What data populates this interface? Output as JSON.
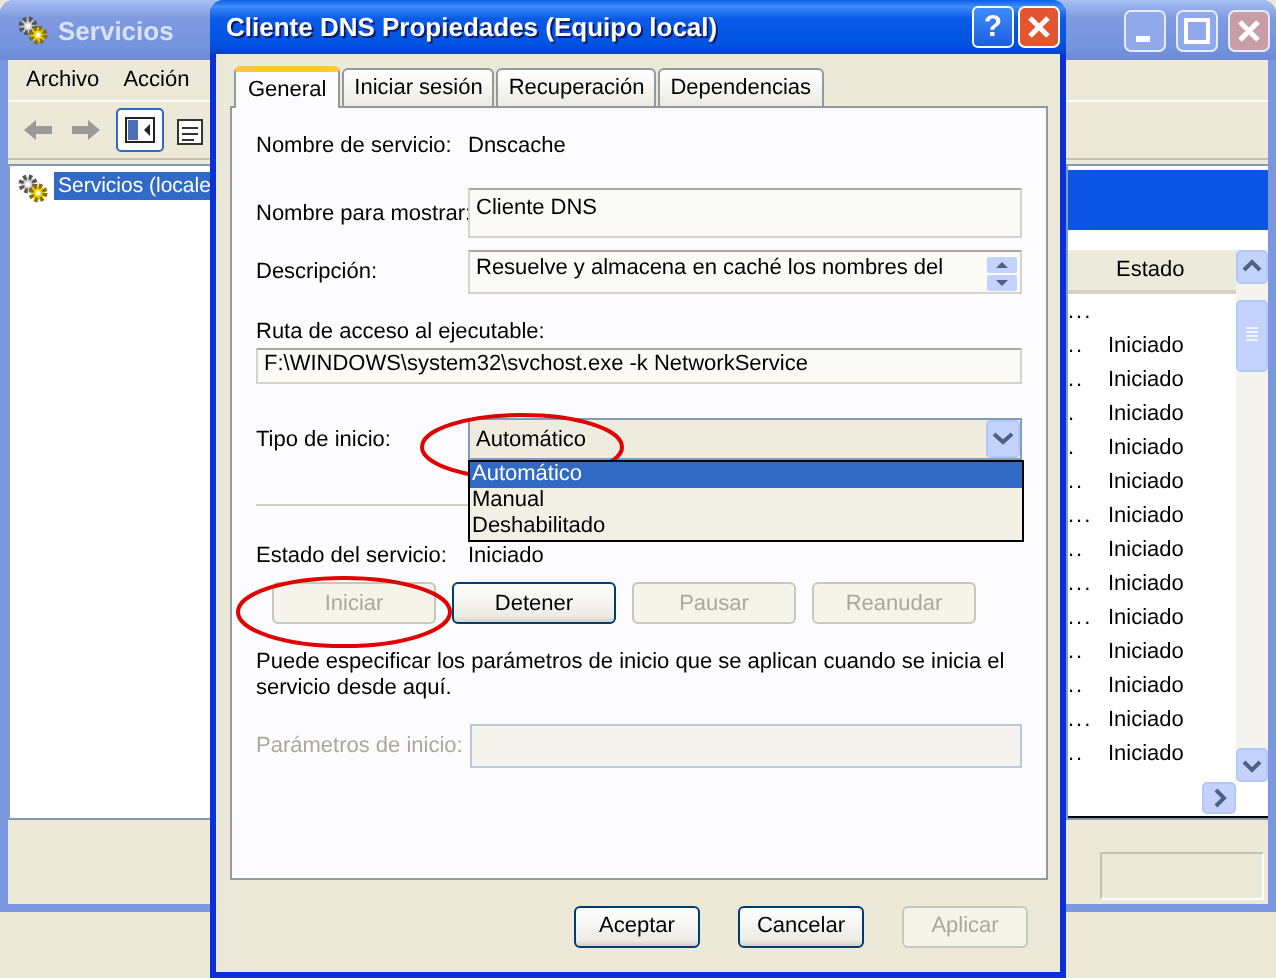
{
  "services_window": {
    "title": "Servicios",
    "menu": [
      "Archivo",
      "Acción"
    ],
    "tree": [
      {
        "label": "Servicios (locale",
        "selected": true
      }
    ],
    "table": {
      "columns": [
        "Estado"
      ],
      "rows": [
        {
          "column_1": "..."
        },
        {
          "column_1": "..",
          "estado": "Iniciado"
        },
        {
          "column_1": "..",
          "estado": "Iniciado"
        },
        {
          "column_1": ".",
          "estado": "Iniciado"
        },
        {
          "column_1": ".",
          "estado": "Iniciado"
        },
        {
          "column_1": "..",
          "estado": "Iniciado"
        },
        {
          "column_1": "...",
          "estado": "Iniciado"
        },
        {
          "column_1": "..",
          "estado": "Iniciado"
        },
        {
          "column_1": "...",
          "estado": "Iniciado"
        },
        {
          "column_1": "...",
          "estado": "Iniciado"
        },
        {
          "column_1": "..",
          "estado": "Iniciado"
        },
        {
          "column_1": "..",
          "estado": "Iniciado"
        },
        {
          "column_1": "...",
          "estado": "Iniciado"
        },
        {
          "column_1": "..",
          "estado": "Iniciado"
        }
      ]
    }
  },
  "dialog": {
    "title": "Cliente DNS Propiedades (Equipo local)",
    "help_button": "?",
    "tabs": [
      {
        "label": "General",
        "selected": true
      },
      {
        "label": "Iniciar sesión",
        "selected": false
      },
      {
        "label": "Recuperación",
        "selected": false
      },
      {
        "label": "Dependencias",
        "selected": false
      }
    ],
    "service_name": {
      "label": "Nombre de servicio:",
      "value": "Dnscache"
    },
    "display_name": {
      "label": "Nombre para mostrar:",
      "value": "Cliente DNS"
    },
    "description": {
      "label": "Descripción:",
      "value": "Resuelve y almacena en caché los nombres del"
    },
    "path": {
      "label": "Ruta de acceso al ejecutable:",
      "value": "F:\\WINDOWS\\system32\\svchost.exe -k NetworkService"
    },
    "startup_type": {
      "label": "Tipo de inicio:",
      "value": "Automático",
      "expanded": true,
      "options": [
        {
          "label": "Automático",
          "selected": true
        },
        {
          "label": "Manual",
          "selected": false
        },
        {
          "label": "Deshabilitado",
          "selected": false
        }
      ]
    },
    "service_status": {
      "label": "Estado del servicio:",
      "value": "Iniciado"
    },
    "service_buttons": [
      {
        "label": "Iniciar",
        "disabled": true
      },
      {
        "label": "Detener",
        "disabled": false
      },
      {
        "label": "Pausar",
        "disabled": true
      },
      {
        "label": "Reanudar",
        "disabled": true
      }
    ],
    "hint": "Puede especificar los parámetros de inicio que se aplican cuando se inicia el servicio desde aquí.",
    "start_parameters": {
      "label": "Parámetros de inicio:",
      "disabled": true
    },
    "buttons": [
      {
        "label": "Aceptar",
        "disabled": false
      },
      {
        "label": "Cancelar",
        "disabled": false
      },
      {
        "label": "Aplicar",
        "disabled": true
      }
    ]
  }
}
